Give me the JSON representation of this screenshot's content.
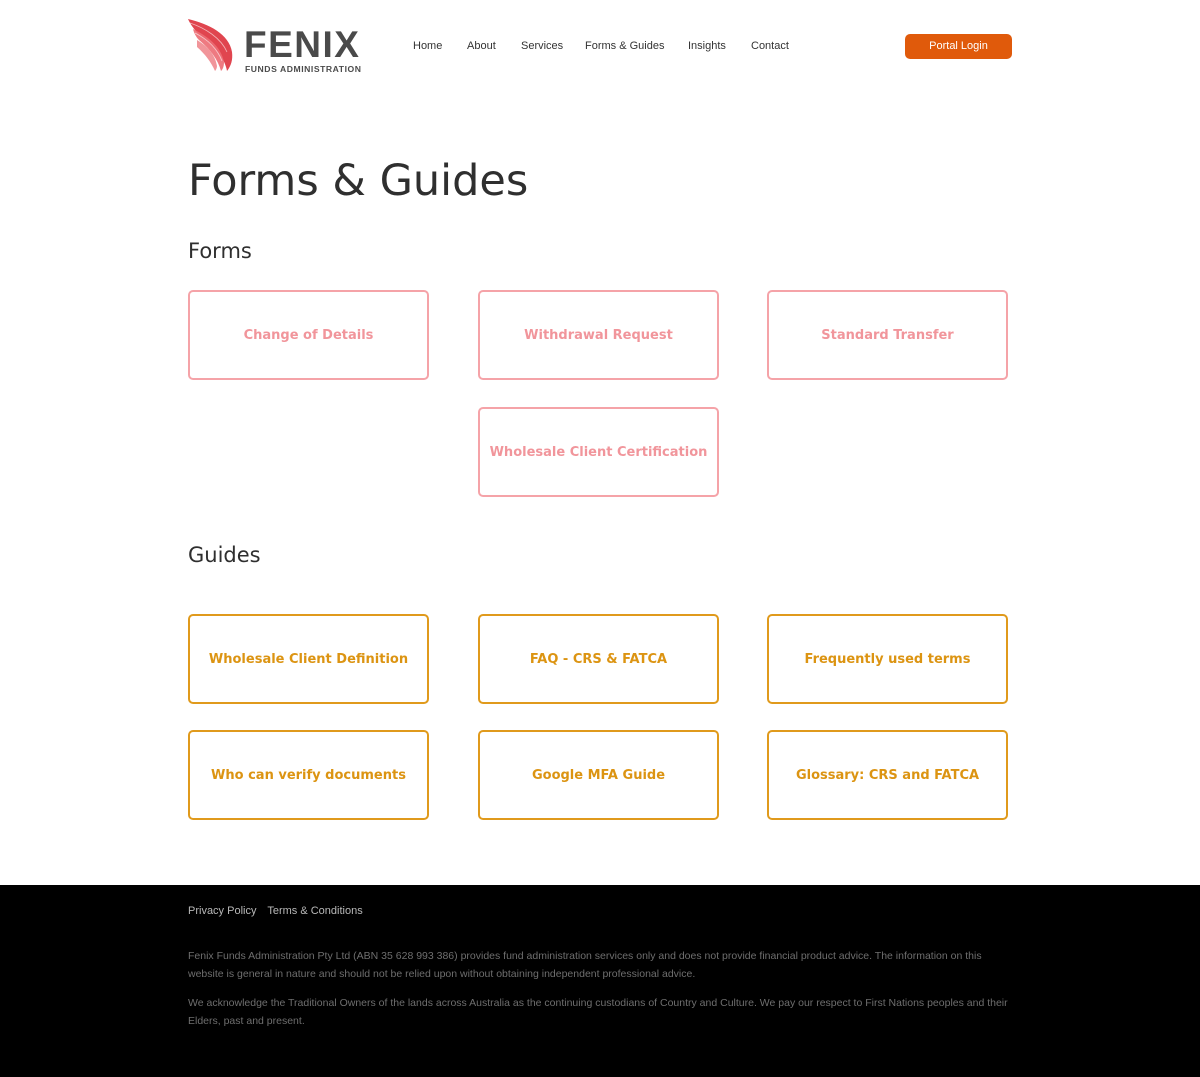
{
  "header": {
    "logo": {
      "word": "FENIX",
      "sub": "FUNDS ADMINISTRATION"
    },
    "nav": [
      {
        "label": "Home"
      },
      {
        "label": "About"
      },
      {
        "label": "Services"
      },
      {
        "label": "Forms & Guides"
      },
      {
        "label": "Insights"
      },
      {
        "label": "Contact"
      }
    ],
    "portal_login": "Portal Login"
  },
  "main": {
    "title": "Forms & Guides",
    "forms": {
      "heading": "Forms",
      "items": [
        {
          "label": "Change of Details"
        },
        {
          "label": "Withdrawal Request"
        },
        {
          "label": "Standard Transfer"
        },
        {
          "label": "Wholesale Client Certification"
        }
      ]
    },
    "guides": {
      "heading": "Guides",
      "items": [
        {
          "label": "Wholesale Client Definition"
        },
        {
          "label": "FAQ - CRS & FATCA"
        },
        {
          "label": "Frequently used terms"
        },
        {
          "label": "Who can verify documents"
        },
        {
          "label": "Google MFA Guide"
        },
        {
          "label": "Glossary: CRS and FATCA"
        }
      ]
    }
  },
  "footer": {
    "links": [
      {
        "label": "Privacy Policy"
      },
      {
        "label": "Terms & Conditions"
      }
    ],
    "disclaimer": "Fenix Funds Administration Pty Ltd (ABN 35 628 993 386) provides fund administration services only and does not provide financial product advice. The information on this website is general in nature and should not be relied upon without obtaining independent professional advice.",
    "acknowledgement": "We acknowledge the Traditional Owners of the lands across Australia as the continuing custodians of Country and Culture. We pay our respect to First Nations peoples and their Elders, past and present."
  },
  "colors": {
    "brand_orange": "#e05a0b",
    "form_border": "#f5a3a8",
    "guide_border": "#e09a1c",
    "logo_red": "#e0454f"
  },
  "icons": [
    "fenix-wing-logo-icon"
  ]
}
